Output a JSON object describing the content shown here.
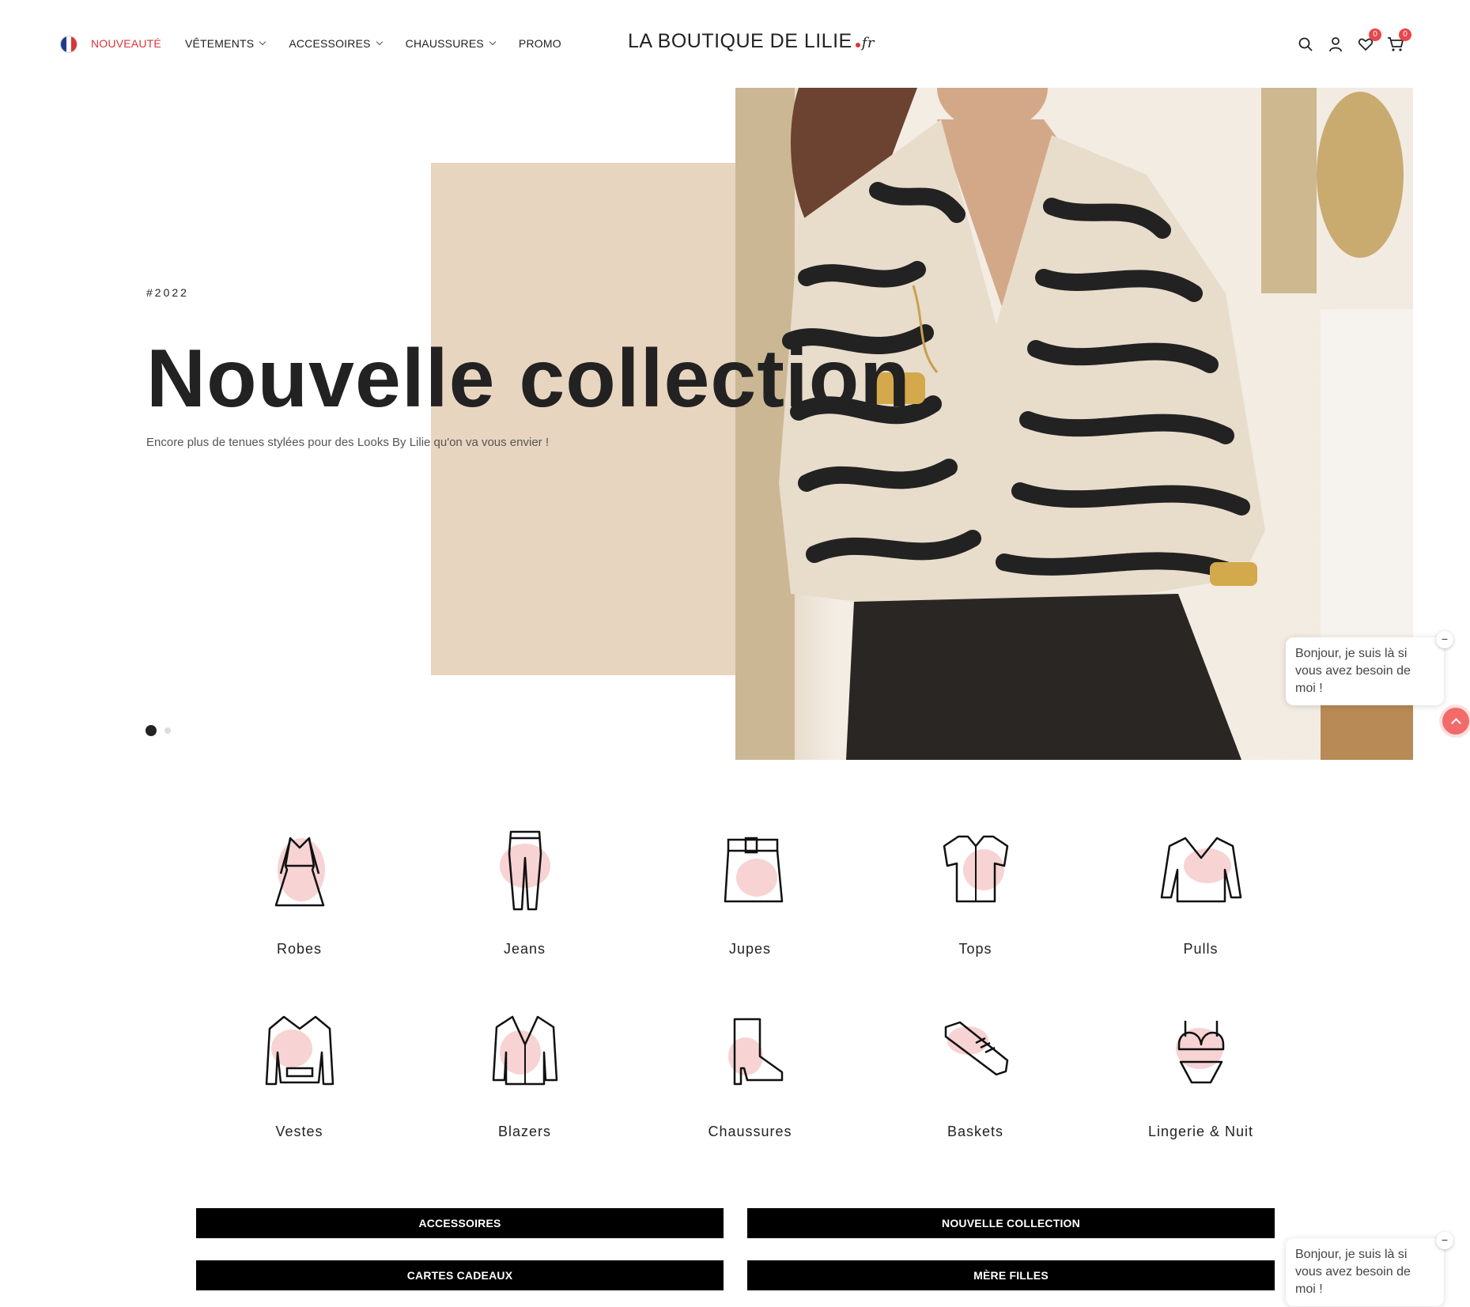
{
  "header": {
    "nav": [
      {
        "label": "NOUVEAUTÉ",
        "active": true,
        "dropdown": false
      },
      {
        "label": "VÊTEMENTS",
        "active": false,
        "dropdown": true
      },
      {
        "label": "ACCESSOIRES",
        "active": false,
        "dropdown": true
      },
      {
        "label": "CHAUSSURES",
        "active": false,
        "dropdown": true
      },
      {
        "label": "PROMO",
        "active": false,
        "dropdown": false
      }
    ],
    "logo_text": "LA BOUTIQUE DE LILIE",
    "logo_suffix": "fr",
    "wishlist_count": "0",
    "cart_count": "0"
  },
  "hero": {
    "hashtag": "#2022",
    "title": "Nouvelle collection",
    "subtitle": "Encore plus de tenues stylées pour des Looks By Lilie qu'on va vous envier !",
    "slides_total": 2,
    "slide_active": 1
  },
  "categories": [
    {
      "label": "Robes",
      "icon": "dress-icon"
    },
    {
      "label": "Jeans",
      "icon": "jeans-icon"
    },
    {
      "label": "Jupes",
      "icon": "skirt-icon"
    },
    {
      "label": "Tops",
      "icon": "top-icon"
    },
    {
      "label": "Pulls",
      "icon": "sweater-icon"
    },
    {
      "label": "Vestes",
      "icon": "jacket-icon"
    },
    {
      "label": "Blazers",
      "icon": "blazer-icon"
    },
    {
      "label": "Chaussures",
      "icon": "boot-icon"
    },
    {
      "label": "Baskets",
      "icon": "sneaker-icon"
    },
    {
      "label": "Lingerie & Nuit",
      "icon": "lingerie-icon"
    }
  ],
  "buttons": {
    "accessoires": "ACCESSOIRES",
    "nouvelle_collection": "NOUVELLE COLLECTION",
    "cartes_cadeaux": "CARTES CADEAUX",
    "mere_filles": "MÈRE FILLES"
  },
  "chat": {
    "message": "Bonjour, je suis là si vous avez besoin de moi !",
    "close_symbol": "−"
  },
  "colors": {
    "accent": "#d9343a",
    "beige": "#e8d5bf",
    "icon_pink": "#f7d3d3"
  }
}
